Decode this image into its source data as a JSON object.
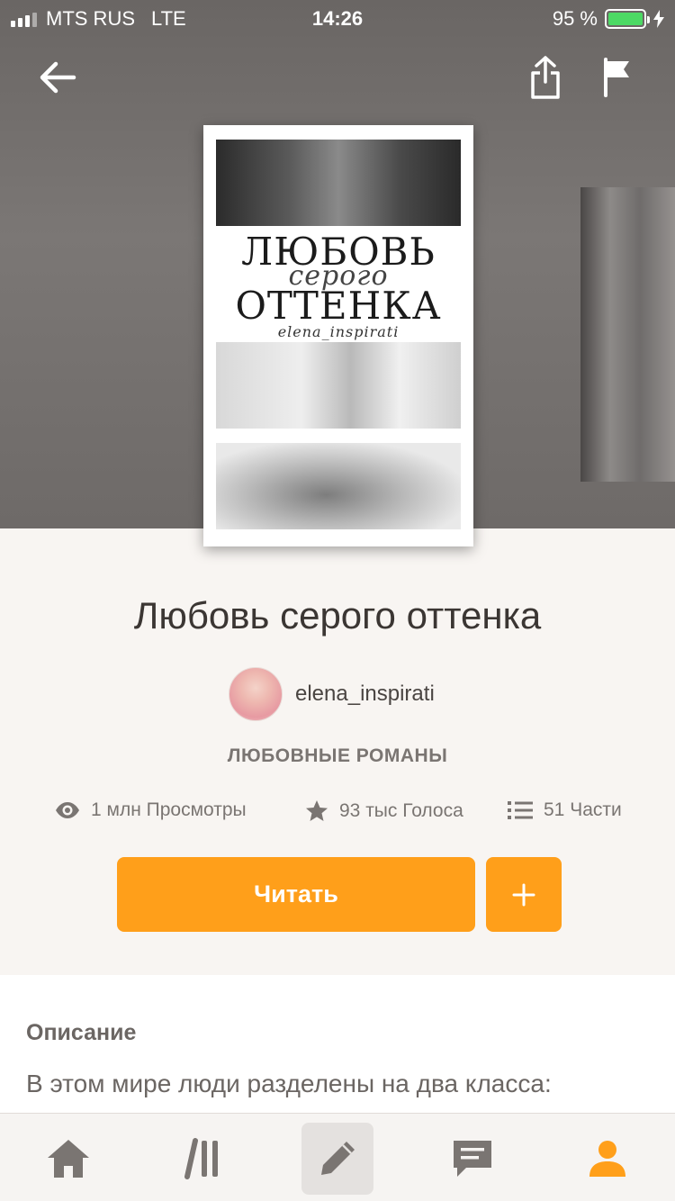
{
  "status_bar": {
    "carrier": "MTS RUS",
    "network": "LTE",
    "time": "14:26",
    "battery_percent": "95 %",
    "battery_level": 0.95
  },
  "header": {
    "back_icon": "arrow-left-icon",
    "share_icon": "share-icon",
    "flag_icon": "flag-icon"
  },
  "cover": {
    "title_line1": "ЛЮБОВЬ",
    "title_line2": "серого",
    "title_line3": "ОТТЕНКА",
    "author": "elena_inspirati"
  },
  "story": {
    "title": "Любовь серого оттенка",
    "author": "elena_inspirati",
    "genre": "ЛЮБОВНЫЕ РОМАНЫ",
    "views": "1 млн Просмотры",
    "votes": "93 тыс Голоса",
    "parts": "51 Части"
  },
  "actions": {
    "read_label": "Читать",
    "add_icon": "plus-icon"
  },
  "description": {
    "heading": "Описание",
    "text": "В этом мире люди разделены на два класса:"
  },
  "tabbar": {
    "items": [
      "home-icon",
      "library-icon",
      "pencil-icon",
      "messages-icon",
      "profile-icon"
    ],
    "active": "pencil-icon",
    "accent_color": "#ff9f1a"
  }
}
